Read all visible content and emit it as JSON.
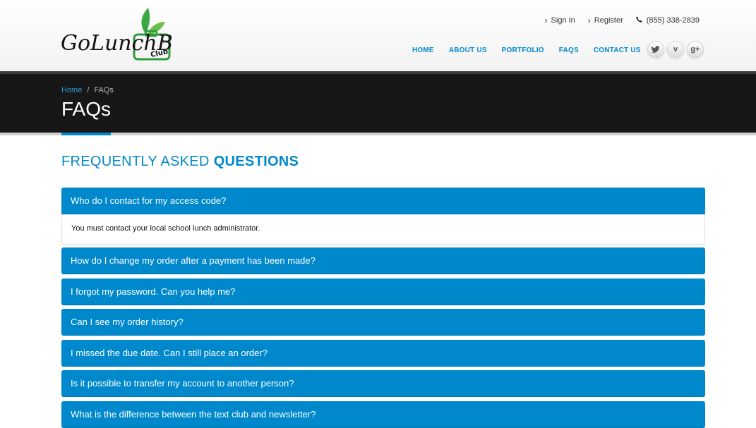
{
  "logo": {
    "text_main": "GoLunchBox",
    "text_sub": "Club",
    "trademark": "TM"
  },
  "toplinks": [
    {
      "label": "Sign In"
    },
    {
      "label": "Register"
    }
  ],
  "phone": "(855) 338-2839",
  "nav": [
    "HOME",
    "ABOUT US",
    "PORTFOLIO",
    "FAQS",
    "CONTACT US"
  ],
  "social": [
    {
      "icon": "twitter-icon",
      "glyph": "🐦"
    },
    {
      "icon": "vimeo-icon",
      "glyph": "v"
    },
    {
      "icon": "google-plus-icon",
      "glyph": "g+"
    }
  ],
  "breadcrumb": {
    "home": "Home",
    "separator": "/",
    "current": "FAQs"
  },
  "page_title": "FAQs",
  "section": {
    "light": "FREQUENTLY ASKED",
    "bold": "QUESTIONS"
  },
  "faqs": [
    {
      "q": "Who do I contact for my access code?",
      "a": "You must contact your local school lunch administrator."
    },
    {
      "q": "How do I change my order after a payment has been made?"
    },
    {
      "q": "I forgot my password. Can you help me?"
    },
    {
      "q": "Can I see my order history?"
    },
    {
      "q": "I missed the due date. Can I still place an order?"
    },
    {
      "q": "Is it possible to transfer my account to another person?"
    },
    {
      "q": "What is the difference between the text club and newsletter?"
    }
  ],
  "colors": {
    "accent": "#0088cc",
    "band": "#171717",
    "logo_green": "#2e9b3e"
  }
}
